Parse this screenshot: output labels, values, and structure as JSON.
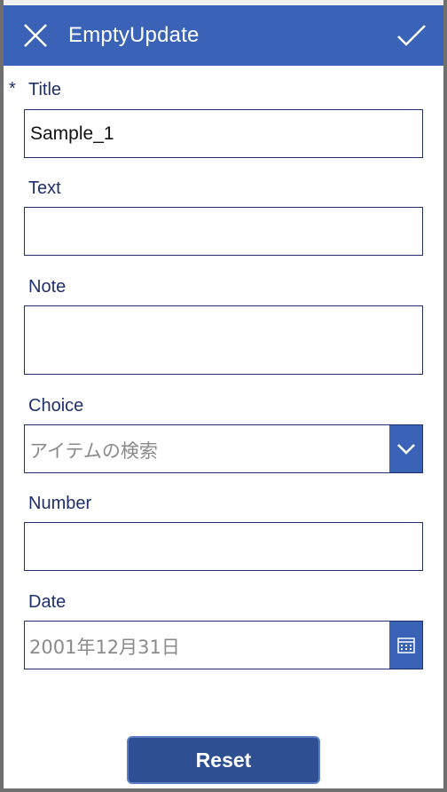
{
  "header": {
    "title": "EmptyUpdate",
    "close_icon": "close-icon",
    "submit_icon": "checkmark-icon"
  },
  "form": {
    "title": {
      "label": "Title",
      "required_marker": "*",
      "value": "Sample_1"
    },
    "text": {
      "label": "Text",
      "value": ""
    },
    "note": {
      "label": "Note",
      "value": ""
    },
    "choice": {
      "label": "Choice",
      "placeholder": "アイテムの検索",
      "icon": "chevron-down-icon"
    },
    "number": {
      "label": "Number",
      "value": ""
    },
    "date": {
      "label": "Date",
      "placeholder": "2001年12月31日",
      "icon": "calendar-icon"
    }
  },
  "actions": {
    "reset_label": "Reset"
  },
  "colors": {
    "accent": "#3a63b7",
    "label_text": "#1f2f6b",
    "button_bg": "#2e4f92"
  }
}
